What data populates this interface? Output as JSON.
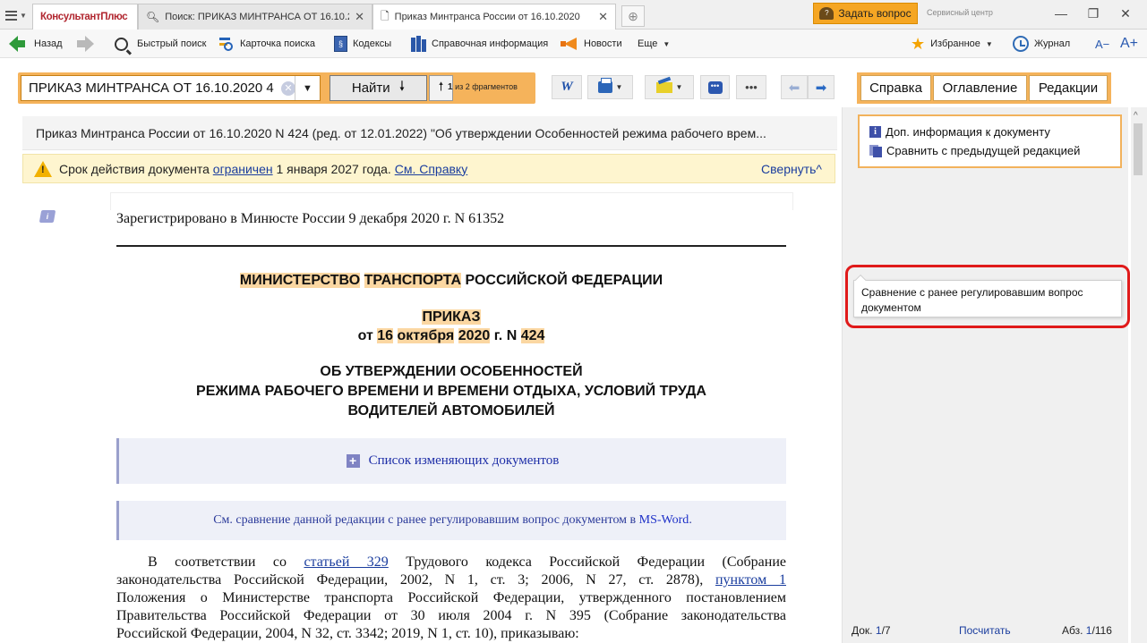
{
  "titlebar": {
    "tabs": [
      {
        "label": "КонсультантПлюс"
      },
      {
        "label": "Поиск: ПРИКАЗ МИНТРАНСА ОТ 16.10.20"
      },
      {
        "label": "Приказ Минтранса России от 16.10.2020"
      }
    ],
    "ask_button": "Задать вопрос",
    "service_center": "Сервисный центр"
  },
  "toolbar": {
    "back": "Назад",
    "quick_search": "Быстрый поиск",
    "search_card": "Карточка поиска",
    "codes": "Кодексы",
    "reference": "Справочная информация",
    "news": "Новости",
    "more": "Еще",
    "favorites": "Избранное",
    "journal": "Журнал",
    "font_smaller": "A−",
    "font_larger": "A+"
  },
  "search": {
    "value": "ПРИКАЗ МИНТРАНСА ОТ 16.10.2020 4",
    "find_label": "Найти",
    "fragments_current": "1",
    "fragments_text": "из 2 фрагментов"
  },
  "right_tabs": [
    "Справка",
    "Оглавление",
    "Редакции"
  ],
  "document": {
    "title": "Приказ Минтранса России от 16.10.2020 N 424 (ред. от 12.01.2022) \"Об утверждении Особенностей режима рабочего врем...",
    "warning": {
      "prefix": "Срок действия документа ",
      "link": "ограничен",
      "middle": " 1 января 2027 года. ",
      "link2": "См. Справку",
      "collapse": "Свернуть"
    },
    "registered": "Зарегистрировано в Минюсте России 9 декабря 2020 г. N 61352",
    "ministry": {
      "w1": "МИНИСТЕРСТВО",
      "w2": "ТРАНСПОРТА",
      "rest": "РОССИЙСКОЙ ФЕДЕРАЦИИ"
    },
    "order": "ПРИКАЗ",
    "order_date": {
      "from": "от",
      "day": "16",
      "month": "октября",
      "year": "2020",
      "suffix": "г. N",
      "num": "424"
    },
    "heading": [
      "ОБ УТВЕРЖДЕНИИ ОСОБЕННОСТЕЙ",
      "РЕЖИМА РАБОЧЕГО ВРЕМЕНИ И ВРЕМЕНИ ОТДЫХА, УСЛОВИЙ ТРУДА",
      "ВОДИТЕЛЕЙ АВТОМОБИЛЕЙ"
    ],
    "changes_list": "Список изменяющих документов",
    "compare_text": "См. сравнение данной редакции с ранее регулировавшим вопрос документом в ",
    "compare_link": "MS-Word",
    "compare_end": ".",
    "paragraph": {
      "l1a": "В соответствии со ",
      "l1link": "статьей 329",
      "l1b": " Трудового кодекса Российской Федерации (Собрание",
      "l2a": "законодательства Российской Федерации, 2002, N 1, ст. 3; 2006, N 27, ст. 2878), ",
      "l2link": "пунктом 1",
      "l3": "Положения о Министерстве транспорта Российской Федерации, утвержденного постановлением",
      "l4": "Правительства Российской Федерации от 30 июля 2004 г. N 395 (Собрание законодательства",
      "l5": "Российской Федерации, 2004, N 32, ст. 3342; 2019, N 1, ст. 10), приказываю:"
    }
  },
  "right_panel": {
    "extra_info": "Доп. информация к документу",
    "compare_prev": "Сравнить с предыдущей редакцией",
    "tooltip": "Сравнение с ранее регулировавшим вопрос документом",
    "doc_label": "Док.",
    "doc_value": "1",
    "doc_total": "/7",
    "count": "Посчитать",
    "abz_label": "Абз.",
    "abz_value": "1",
    "abz_total": "/116"
  },
  "colors": {
    "accent_orange": "#f5b35b",
    "highlight": "#fbd7a2",
    "link_blue": "#1a3d9e",
    "annotation_red": "#e01a1a"
  }
}
